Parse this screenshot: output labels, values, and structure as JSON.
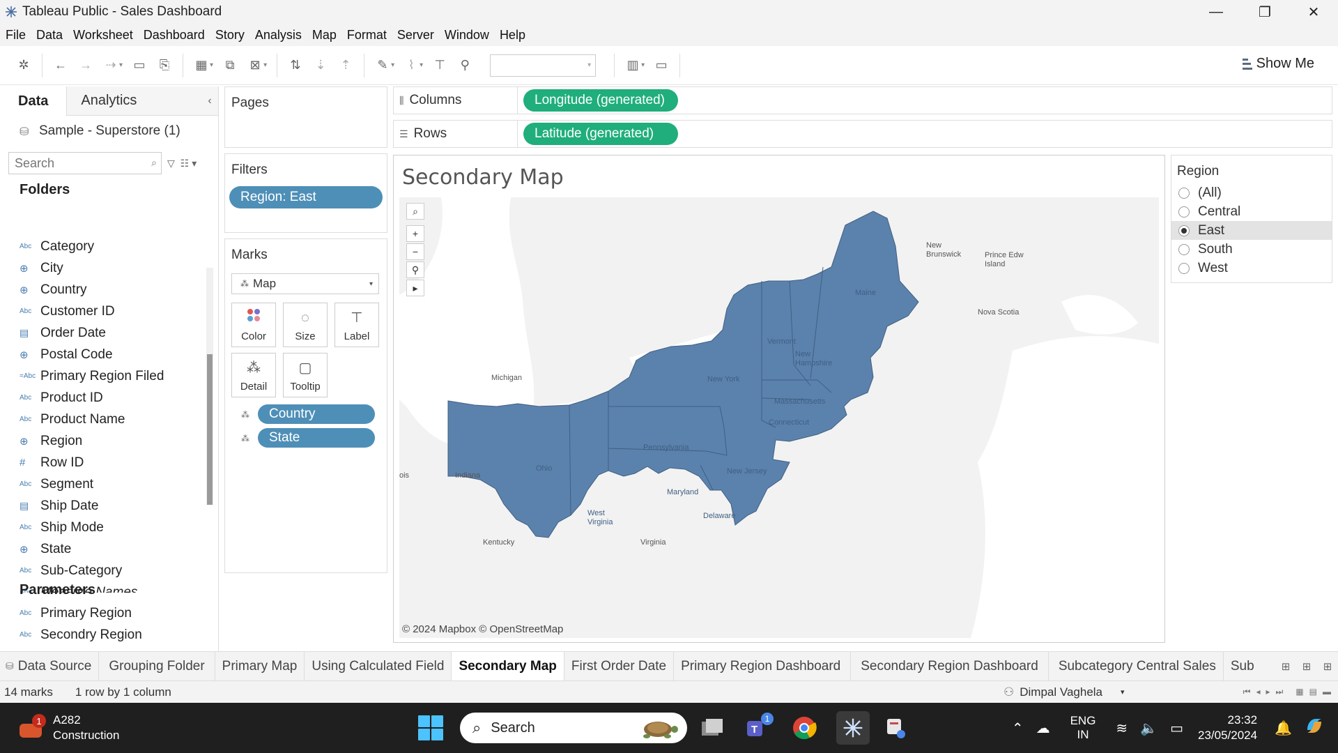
{
  "window": {
    "title": "Tableau Public - Sales Dashboard",
    "controls": [
      "—",
      "❐",
      "✕"
    ]
  },
  "menu": [
    "File",
    "Data",
    "Worksheet",
    "Dashboard",
    "Story",
    "Analysis",
    "Map",
    "Format",
    "Server",
    "Window",
    "Help"
  ],
  "toolbar": {
    "show_me_label": "Show Me"
  },
  "data_pane": {
    "tabs": [
      "Data",
      "Analytics"
    ],
    "data_source": "Sample - Superstore (1)",
    "search_placeholder": "Search",
    "folders_title": "Folders",
    "fields": [
      {
        "type": "Abc",
        "label": "Category"
      },
      {
        "type": "globe",
        "label": "City"
      },
      {
        "type": "globe",
        "label": "Country"
      },
      {
        "type": "Abc",
        "label": "Customer ID"
      },
      {
        "type": "date",
        "label": "Order Date"
      },
      {
        "type": "globe",
        "label": "Postal Code"
      },
      {
        "type": "Abc",
        "label": "Primary Region Filed"
      },
      {
        "type": "Abc",
        "label": "Product ID"
      },
      {
        "type": "Abc",
        "label": "Product Name"
      },
      {
        "type": "globe",
        "label": "Region"
      },
      {
        "type": "#",
        "label": "Row ID"
      },
      {
        "type": "Abc",
        "label": "Segment"
      },
      {
        "type": "date",
        "label": "Ship Date"
      },
      {
        "type": "Abc",
        "label": "Ship Mode"
      },
      {
        "type": "globe",
        "label": "State"
      },
      {
        "type": "Abc",
        "label": "Sub-Category"
      },
      {
        "type": "Abc",
        "label": "Measure Names"
      }
    ],
    "parameters_title": "Parameters",
    "parameters": [
      {
        "type": "Abc",
        "label": "Primary Region"
      },
      {
        "type": "Abc",
        "label": "Secondry Region"
      }
    ]
  },
  "pages_title": "Pages",
  "filters": {
    "title": "Filters",
    "items": [
      "Region: East"
    ]
  },
  "marks": {
    "title": "Marks",
    "type": "Map",
    "buttons": [
      "Color",
      "Size",
      "Label",
      "Detail",
      "Tooltip"
    ],
    "pills": [
      "Country",
      "State"
    ]
  },
  "columns": {
    "label": "Columns",
    "pill": "Longitude (generated)"
  },
  "rows": {
    "label": "Rows",
    "pill": "Latitude (generated)"
  },
  "view": {
    "title": "Secondary Map",
    "attribution": "© 2024 Mapbox © OpenStreetMap",
    "map_labels": {
      "new_brunswick": "New\nBrunswick",
      "prince_edward": "Prince Edw\nIsland",
      "nova_scotia": "Nova Scotia",
      "maine": "Maine",
      "vermont": "Vermont",
      "new_hampshire": "New\nHampshire",
      "new_york": "New York",
      "massachusetts": "Massachusetts",
      "connecticut": "Connecticut",
      "pennsylvania": "Pennsylvania",
      "new_jersey": "New Jersey",
      "ohio": "Ohio",
      "michigan": "Michigan",
      "indiana": "Indiana",
      "illinois": "ois",
      "west_virginia": "West\nVirginia",
      "maryland": "Maryland",
      "delaware": "Delaware",
      "kentucky": "Kentucky",
      "virginia": "Virginia"
    },
    "fill_color": "#5b82ad"
  },
  "region_legend": {
    "title": "Region",
    "options": [
      "(All)",
      "Central",
      "East",
      "South",
      "West"
    ],
    "selected": "East"
  },
  "sheet_tabs": {
    "tabs": [
      "Data Source",
      "Grouping Folder",
      "Primary Map",
      "Using Calculated Field",
      "Secondary Map",
      "First Order Date",
      "Primary Region Dashboard",
      "Secondary Region Dashboard",
      "Subcategory Central Sales",
      "Sub"
    ],
    "active": "Secondary Map"
  },
  "status": {
    "marks": "14 marks",
    "rows_cols": "1 row by 1 column",
    "user": "Dimpal Vaghela"
  },
  "taskbar": {
    "weather_title": "A282",
    "weather_sub": "Construction",
    "weather_badge": "1",
    "search_label": "Search",
    "teams_badge": "1",
    "lang_top": "ENG",
    "lang_bottom": "IN",
    "time": "23:32",
    "date": "23/05/2024"
  },
  "colors": {
    "filter_pill": "#4e8fb7",
    "shelf_pill": "#1fae7c",
    "taskbar": "#1f1f1f"
  }
}
